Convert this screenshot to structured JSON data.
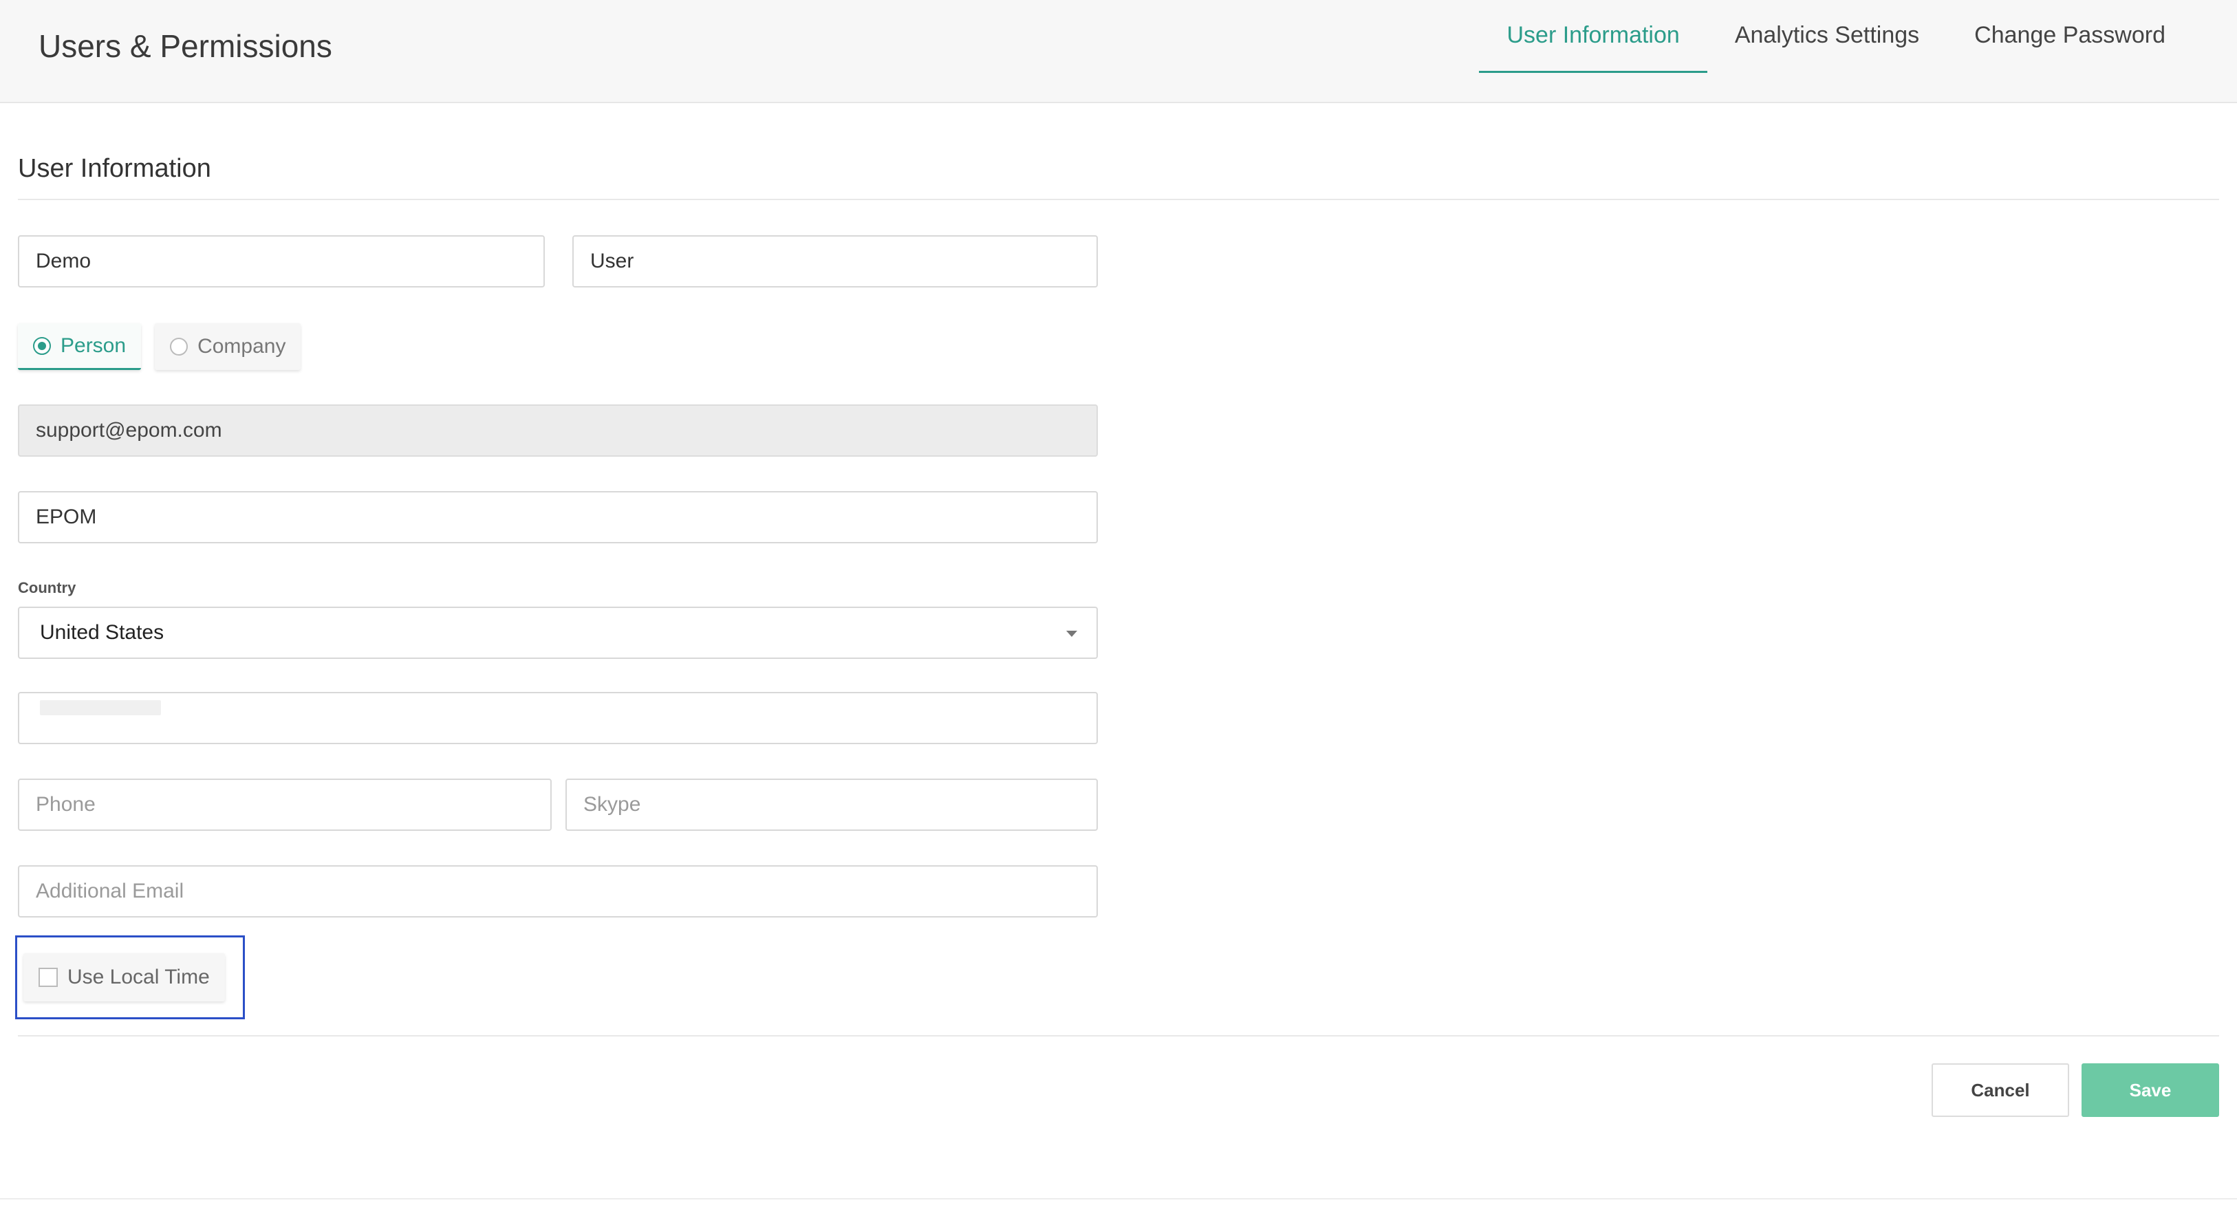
{
  "header": {
    "title": "Users & Permissions",
    "tabs": [
      {
        "label": "User Information",
        "active": true
      },
      {
        "label": "Analytics Settings",
        "active": false
      },
      {
        "label": "Change Password",
        "active": false
      }
    ]
  },
  "section": {
    "title": "User Information"
  },
  "form": {
    "first_name": {
      "value": "Demo"
    },
    "last_name": {
      "value": "User"
    },
    "type": {
      "options": [
        {
          "label": "Person",
          "selected": true
        },
        {
          "label": "Company",
          "selected": false
        }
      ]
    },
    "email": {
      "value": "support@epom.com"
    },
    "company": {
      "value": "EPOM"
    },
    "country": {
      "label": "Country",
      "value": "United States"
    },
    "phone": {
      "value": "",
      "placeholder": "Phone"
    },
    "skype": {
      "value": "",
      "placeholder": "Skype"
    },
    "additional_email": {
      "value": "",
      "placeholder": "Additional Email"
    },
    "use_local_time": {
      "label": "Use Local Time",
      "checked": false
    }
  },
  "actions": {
    "cancel_label": "Cancel",
    "save_label": "Save"
  },
  "colors": {
    "accent": "#2b9c8a",
    "save_button": "#6cc9a4",
    "focus_outline": "#2b4fc7"
  },
  "icons": {
    "country_dropdown": "chevron-down-icon"
  }
}
